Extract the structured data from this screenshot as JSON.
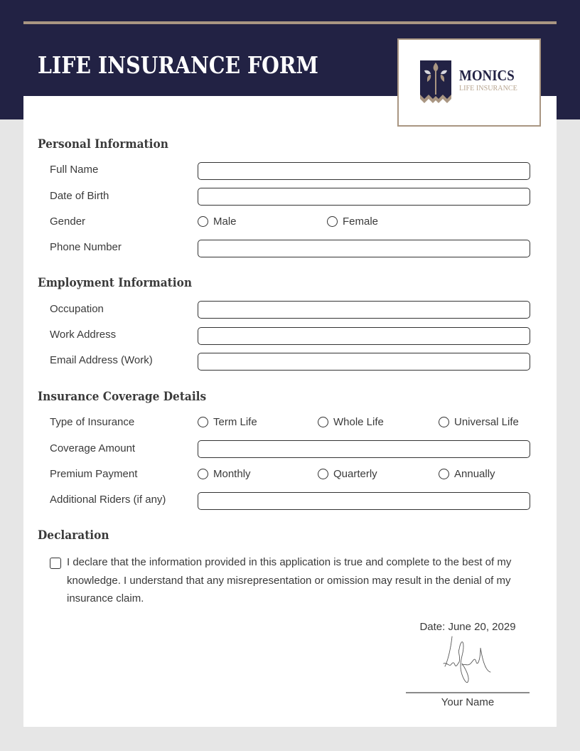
{
  "header": {
    "title": "LIFE INSURANCE FORM",
    "accent_color": "#a99682",
    "background_color": "#222244"
  },
  "logo": {
    "icon": "tree-banner-icon",
    "name": "MONICS",
    "subtitle": "LIFE INSURANCE"
  },
  "sections": {
    "personal": {
      "title": "Personal Information",
      "full_name": {
        "label": "Full Name",
        "value": ""
      },
      "date_of_birth": {
        "label": "Date of Birth",
        "value": ""
      },
      "gender": {
        "label": "Gender",
        "options": [
          "Male",
          "Female"
        ],
        "selected": null
      },
      "phone_number": {
        "label": "Phone Number",
        "value": ""
      }
    },
    "employment": {
      "title": "Employment Information",
      "occupation": {
        "label": "Occupation",
        "value": ""
      },
      "work_address": {
        "label": "Work Address",
        "value": ""
      },
      "email_work": {
        "label": "Email Address (Work)",
        "value": ""
      }
    },
    "coverage": {
      "title": "Insurance Coverage Details",
      "type_of_insurance": {
        "label": "Type of Insurance",
        "options": [
          "Term Life",
          "Whole Life",
          "Universal Life"
        ],
        "selected": null
      },
      "coverage_amount": {
        "label": "Coverage Amount",
        "value": ""
      },
      "premium_payment": {
        "label": "Premium Payment",
        "options": [
          "Monthly",
          "Quarterly",
          "Annually"
        ],
        "selected": null
      },
      "additional_riders": {
        "label": "Additional Riders (if any)",
        "value": ""
      }
    },
    "declaration": {
      "title": "Declaration",
      "checked": false,
      "text": "I declare that the information provided in this application is true and complete to the best of my knowledge. I understand that any misrepresentation or omission may result in the denial of my insurance claim."
    }
  },
  "signature": {
    "date": "Date: June 20, 2029",
    "name": "Your Name"
  }
}
